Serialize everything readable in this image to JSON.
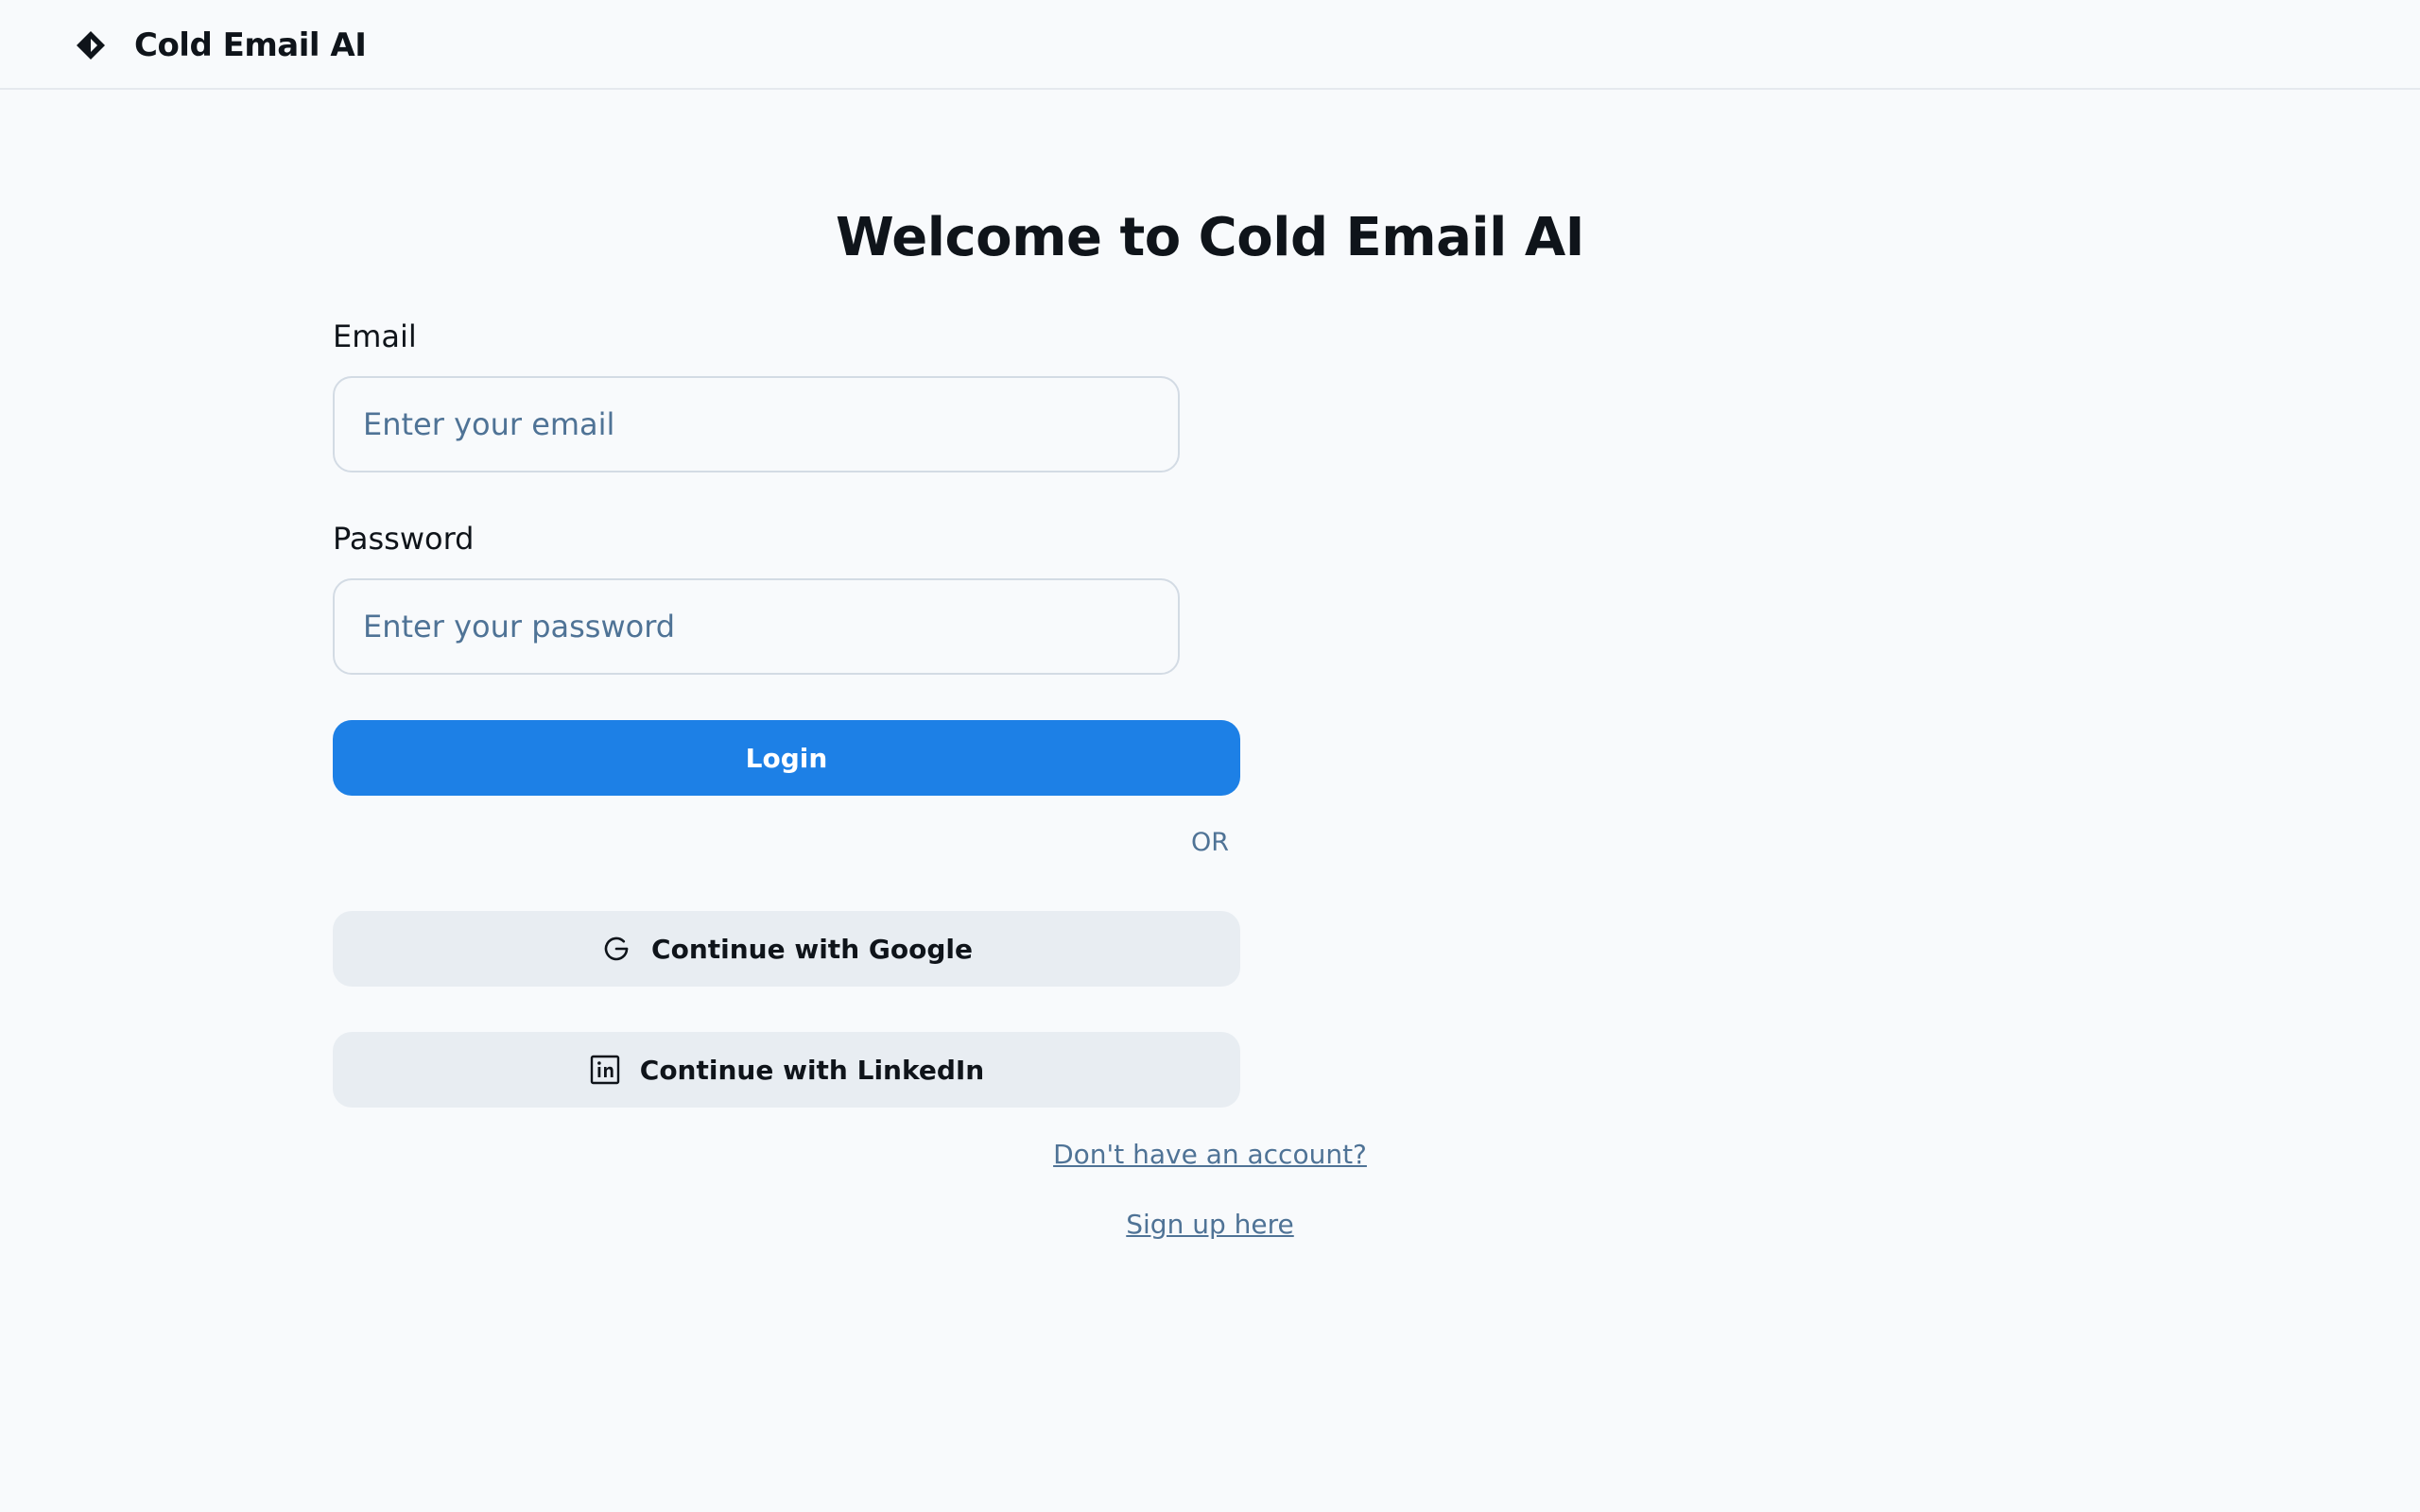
{
  "header": {
    "app_name": "Cold Email AI",
    "logo_icon": "diamond-logo-icon"
  },
  "main": {
    "title": "Welcome to Cold Email AI",
    "email": {
      "label": "Email",
      "placeholder": "Enter your email",
      "value": ""
    },
    "password": {
      "label": "Password",
      "placeholder": "Enter your password",
      "value": ""
    },
    "login_label": "Login",
    "divider_text": "OR",
    "google_label": "Continue with Google",
    "google_icon": "google-icon",
    "linkedin_label": "Continue with LinkedIn",
    "linkedin_icon": "linkedin-icon",
    "no_account_text": "Don't have an account?",
    "signup_text": "Sign up here"
  },
  "colors": {
    "primary": "#1d80e6",
    "background": "#f8fafc",
    "secondary_button": "#e8edf2",
    "muted_text": "#4f7396",
    "text": "#0f141a"
  }
}
